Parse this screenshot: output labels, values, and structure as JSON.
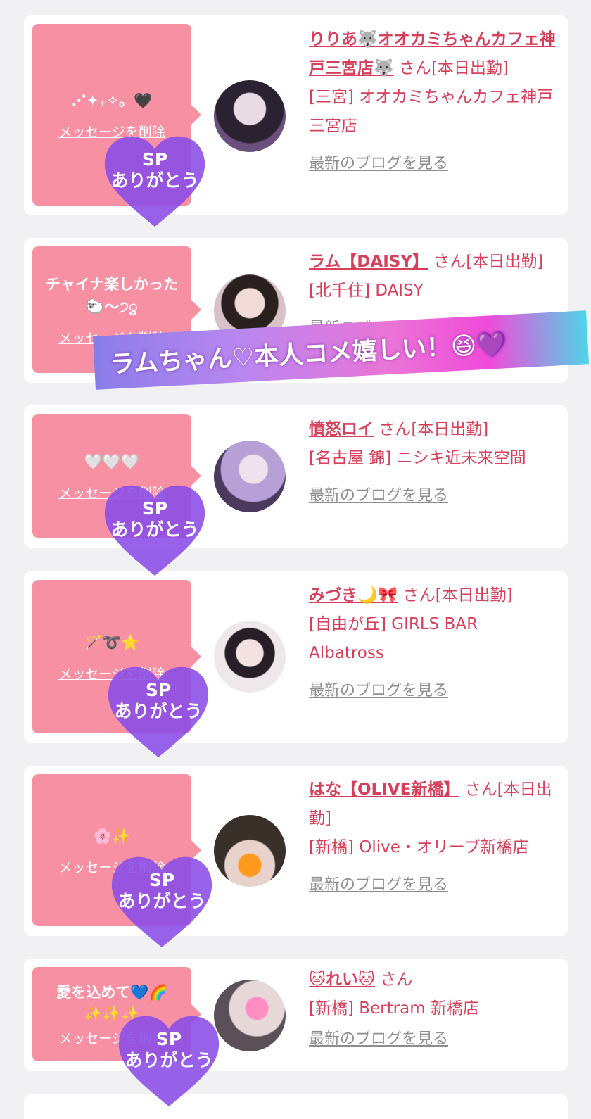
{
  "cards": [
    {
      "message": "⋰✦₊✧。🖤",
      "delete_label": "メッセージを削除",
      "name": "りりあ🐺オオカミちゃんカフェ神戸三宮店🐺",
      "san": "さん[本日出勤]",
      "shop": "[三宮] オオカミちゃんカフェ神戸三宮店",
      "blog": "最新のブログを見る"
    },
    {
      "message": "チャイナ楽しかった🐑〜੭ु",
      "delete_label": "メッセージを削除",
      "name": "ラム【DAISY】",
      "san": "さん[本日出勤]",
      "shop": "[北千住] DAISY",
      "blog": "最新のブログを見る"
    },
    {
      "message": "🤍🤍🤍",
      "delete_label": "メッセージを削除",
      "name": "憤怒ロイ",
      "san": "さん[本日出勤]",
      "shop": "[名古屋 錦] ニシキ近未来空間",
      "blog": "最新のブログを見る"
    },
    {
      "message": "🪄➰⭐",
      "delete_label": "メッセージを削除",
      "name": "みづき🌙🎀",
      "san": "さん[本日出勤]",
      "shop": "[自由が丘] GIRLS BAR Albatross",
      "blog": "最新のブログを見る"
    },
    {
      "message": "🌸✨",
      "delete_label": "メッセージを削除",
      "name": "はな【OLIVE新橋】",
      "san": "さん[本日出勤]",
      "shop": "[新橋] Olive・オリーブ新橋店",
      "blog": "最新のブログを見る"
    },
    {
      "message": "愛を込めて💙🌈✨✨✨",
      "delete_label": "メッセージを削除",
      "name": "🐱れい🐱",
      "san": "さん",
      "shop": "[新橋] Bertram 新橋店",
      "blog": "最新のブログを見る"
    }
  ],
  "sticker_text": {
    "line1": "SP",
    "line2": "ありがとう"
  },
  "banner_text": "ラムちゃん♡本人コメ嬉しい！😆💜",
  "colors": {
    "bubble": "#f690a2",
    "name": "#d6405a",
    "heart": "#8a4be6"
  }
}
